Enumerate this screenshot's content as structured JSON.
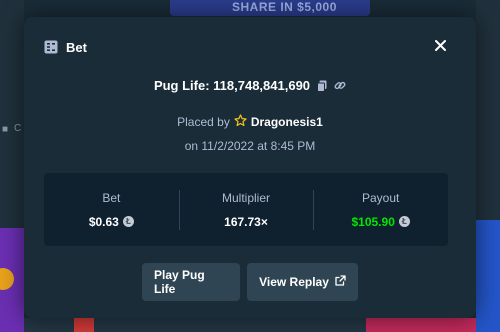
{
  "background": {
    "banner_text": "SHARE IN $5,000",
    "left_text": "C"
  },
  "modal": {
    "title": "Bet",
    "game_line": "Pug Life: 118,748,841,690",
    "placed_prefix": "Placed by",
    "username": "Dragonesis1",
    "date": "on 11/2/2022 at 8:45 PM",
    "stats": {
      "bet_label": "Bet",
      "bet_value": "$0.63",
      "multiplier_label": "Multiplier",
      "multiplier_value": "167.73×",
      "payout_label": "Payout",
      "payout_value": "$105.90"
    },
    "buttons": {
      "play_label": "Play Pug Life",
      "replay_label": "View Replay"
    }
  },
  "colors": {
    "modal_bg": "#1a2c38",
    "stats_bg": "#0f212e",
    "button_bg": "#2f4553",
    "payout_green": "#00e701",
    "muted_text": "#b1bad3",
    "star_yellow": "#f5c518"
  },
  "icons": {
    "header": "bet-slip-icon",
    "close": "close-icon",
    "copy": "copy-icon",
    "link": "link-icon",
    "user_badge": "star-icon",
    "currency": "litecoin-icon",
    "external": "external-link-icon"
  }
}
